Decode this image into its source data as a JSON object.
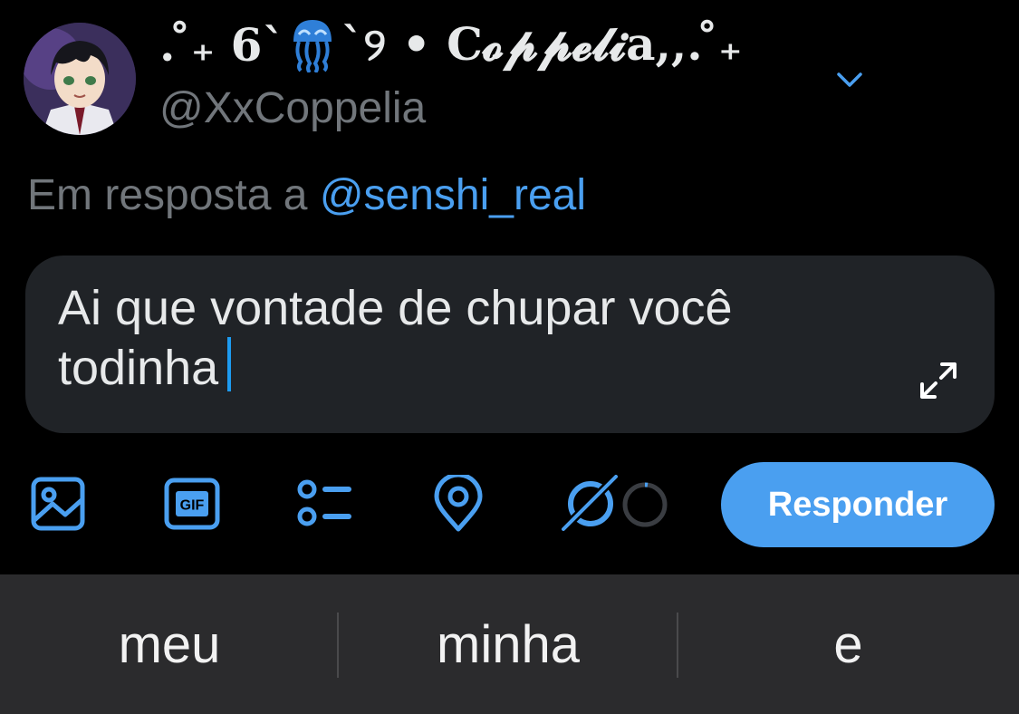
{
  "profile": {
    "display_name_prefix": ". ̊₊ 6`",
    "display_name_suffix": "`୨ • 𝐂𝓸𝓹𝓹𝓮𝓵𝓲𝐚,,. ̊₊",
    "display_name_emoji": "jellyfish-icon",
    "handle": "@XxCoppelia"
  },
  "reply": {
    "prefix": "Em resposta a ",
    "mention": "@senshi_real"
  },
  "composer": {
    "text": "Ai que vontade de chupar você todinha"
  },
  "toolbar": {
    "icons": [
      "image-icon",
      "gif-icon",
      "poll-icon",
      "location-icon",
      "grok-icon",
      "character-counter"
    ],
    "gif_label": "GIF",
    "reply_label": "Responder"
  },
  "keyboard": {
    "suggestions": [
      "meu",
      "minha",
      "e"
    ]
  },
  "colors": {
    "background": "#000000",
    "accent": "#4a9ff0",
    "muted_text": "#71767b",
    "composer_bg": "#202327",
    "keyboard_bg": "#2b2b2d"
  }
}
